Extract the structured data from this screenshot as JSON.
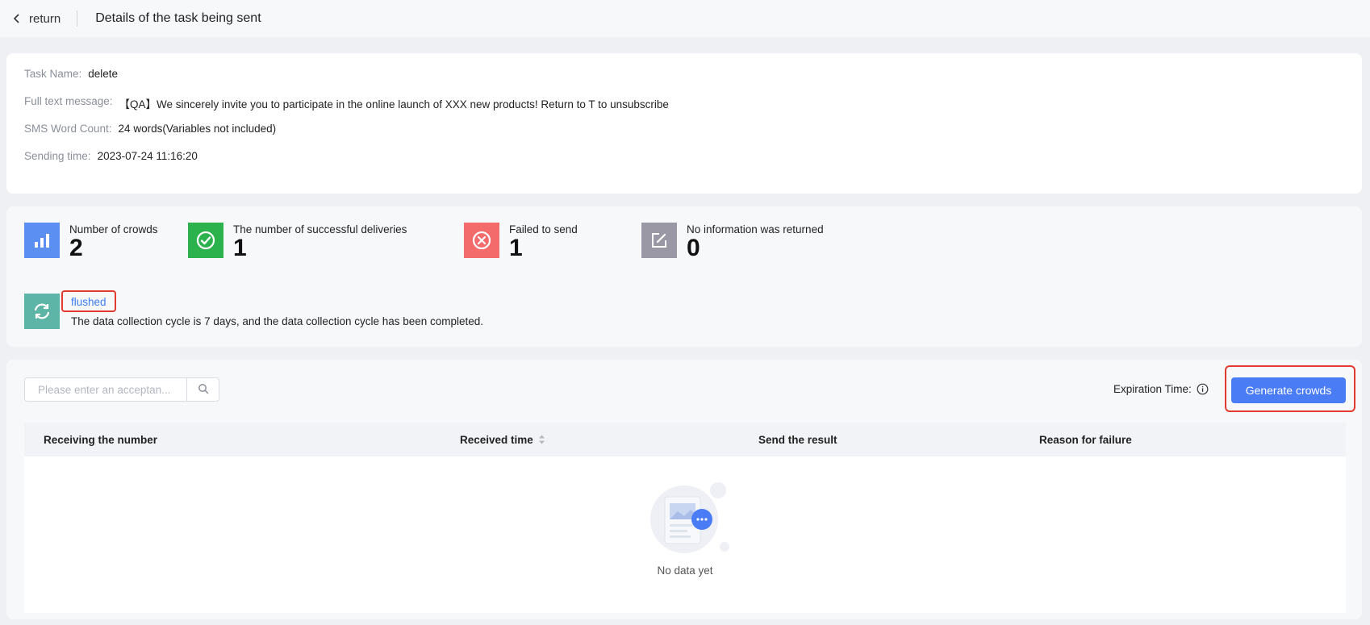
{
  "header": {
    "back_label": "return",
    "title": "Details of the task being sent"
  },
  "task_info": {
    "task_name_label": "Task Name:",
    "task_name": "delete",
    "full_text_label": "Full text message:",
    "full_text": "【QA】We sincerely invite you to participate in the online launch of XXX new products! Return to T to unsubscribe",
    "word_count_label": "SMS Word Count:",
    "word_count": "24 words(Variables not included)",
    "sending_time_label": "Sending time:",
    "sending_time": "2023-07-24 11:16:20"
  },
  "stats": [
    {
      "label": "Number of crowds",
      "value": "2",
      "icon": "bar-chart-icon",
      "color": "#5b8ff2"
    },
    {
      "label": "The number of successful deliveries",
      "value": "1",
      "icon": "check-circle-icon",
      "color": "#2bb24c"
    },
    {
      "label": "Failed to send",
      "value": "1",
      "icon": "close-circle-icon",
      "color": "#f46b6b"
    },
    {
      "label": "No information was returned",
      "value": "0",
      "icon": "edit-icon",
      "color": "#9b98a6"
    }
  ],
  "refresh": {
    "status": "flushed",
    "description": "The data collection cycle is 7 days, and the data collection cycle has been completed."
  },
  "toolbar": {
    "search_placeholder": "Please enter an acceptan...",
    "expiration_label": "Expiration Time:",
    "generate_label": "Generate crowds"
  },
  "table": {
    "columns": [
      "Receiving the number",
      "Received time",
      "Send the result",
      "Reason for failure"
    ],
    "empty_text": "No data yet"
  },
  "colors": {
    "primary": "#4a7cf5",
    "highlight_outline": "#e23b2e",
    "refresh_icon_bg": "#5cb5a7"
  }
}
